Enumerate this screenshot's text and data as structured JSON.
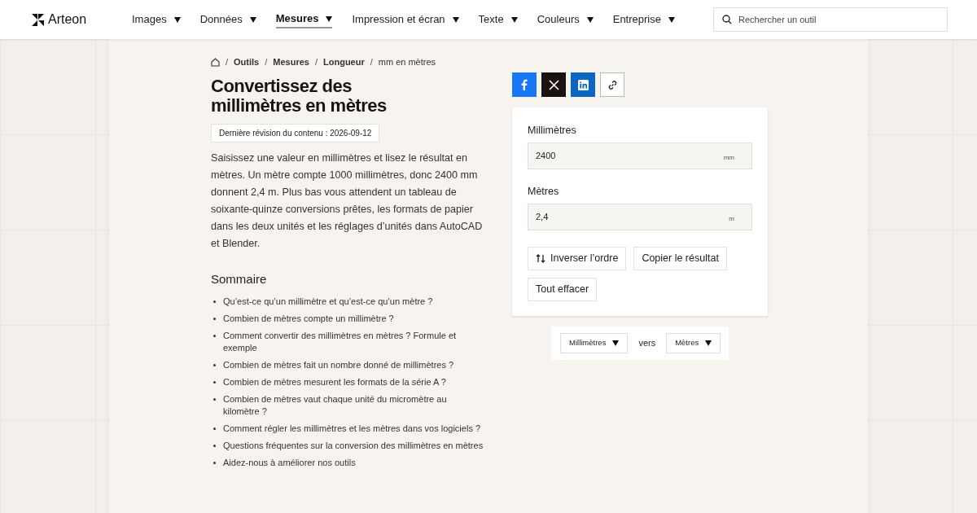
{
  "header": {
    "logo": "Arteon",
    "nav": [
      {
        "label": "Images",
        "selected": false
      },
      {
        "label": "Données",
        "selected": false
      },
      {
        "label": "Mesures",
        "selected": true
      },
      {
        "label": "Impression et écran",
        "selected": false
      },
      {
        "label": "Texte",
        "selected": false
      },
      {
        "label": "Couleurs",
        "selected": false
      },
      {
        "label": "Entreprise",
        "selected": false
      }
    ],
    "search": {
      "placeholder": "Rechercher un outil"
    }
  },
  "breadcrumb": {
    "separator": "/",
    "links": [
      "Outils",
      "Mesures",
      "Longueur"
    ],
    "current": "mm en mètres"
  },
  "title": "Convertissez des millimètres en mètres",
  "revision": "Dernière révision du contenu : 2026-09-12",
  "intro": "Saisissez une valeur en millimètres et lisez le résultat en mètres. Un mètre compte 1000 millimètres, donc 2400 mm donnent 2,4 m. Plus bas vous attendent un tableau de soixante-quinze conversions prêtes, les formats de papier dans les deux unités et les réglages d’unités dans AutoCAD et Blender.",
  "toc": {
    "title": "Sommaire",
    "items": [
      "Qu’est-ce qu’un millimètre et qu’est-ce qu’un mètre ?",
      "Combien de mètres compte un millimètre ?",
      "Comment convertir des millimètres en mètres ? Formule et exemple",
      "Combien de mètres fait un nombre donné de millimètres ?",
      "Combien de mètres mesurent les formats de la série A ?",
      "Combien de mètres vaut chaque unité du micromètre au kilomètre ?",
      "Comment régler les millimètres et les mètres dans vos logiciels ?",
      "Questions fréquentes sur la conversion des millimètres en mètres",
      "Aidez-nous à améliorer nos outils"
    ]
  },
  "share": [
    {
      "kind": "facebook"
    },
    {
      "kind": "x"
    },
    {
      "kind": "linkedin"
    },
    {
      "kind": "link"
    }
  ],
  "converter": {
    "fields": [
      {
        "label": "Millimètres",
        "value": "2400",
        "unit": "mm"
      },
      {
        "label": "Mètres",
        "value": "2,4",
        "unit": "m"
      }
    ],
    "buttons": [
      {
        "label": "Inverser l’ordre",
        "kind": "swap"
      },
      {
        "label": "Copier le résultat",
        "kind": "plain"
      },
      {
        "label": "Tout effacer",
        "kind": "plain"
      }
    ]
  },
  "units": {
    "from": "Millimètres",
    "joiner": "vers",
    "to": "Mètres"
  }
}
